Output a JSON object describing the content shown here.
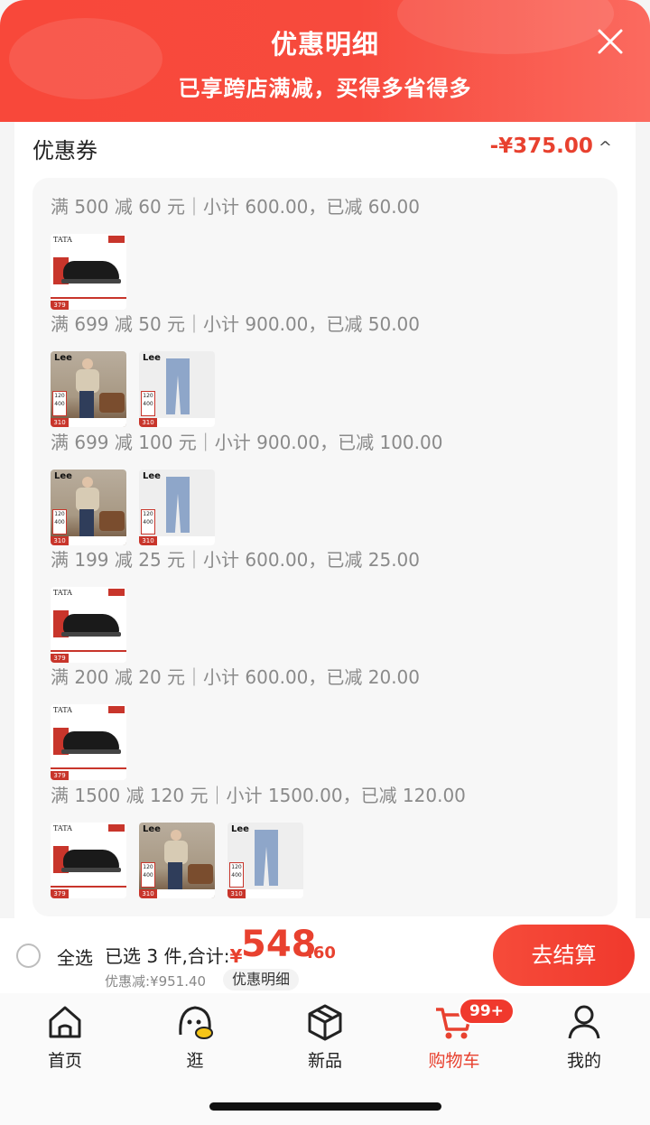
{
  "header": {
    "title": "优惠明细",
    "subtitle": "已享跨店满减，买得多省得多",
    "close_icon": "close-icon"
  },
  "coupon": {
    "label": "优惠券",
    "total": "-¥375.00",
    "caret": "^"
  },
  "groups": [
    {
      "rule": "满 500 减 60 元｜小计 600.00，已减 60.00",
      "items": [
        "shoe"
      ]
    },
    {
      "rule": "满 699 减 50 元｜小计 900.00，已减 50.00",
      "items": [
        "man",
        "jeans"
      ]
    },
    {
      "rule": "满 699 减 100 元｜小计 900.00，已减 100.00",
      "items": [
        "man",
        "jeans"
      ]
    },
    {
      "rule": "满 199 减 25 元｜小计 600.00，已减 25.00",
      "items": [
        "shoe"
      ]
    },
    {
      "rule": "满 200 减 20 元｜小计 600.00，已减 20.00",
      "items": [
        "shoe"
      ]
    },
    {
      "rule": "满 1500 减 120 元｜小计 1500.00，已减 120.00",
      "items": [
        "shoe",
        "man",
        "jeans"
      ]
    }
  ],
  "thumbs": {
    "shoe_brand": "TATA",
    "shoe_price": "379",
    "lee_brand": "Lee",
    "lee_price": "310",
    "lee_card_top": "120",
    "lee_card_bottom": "400"
  },
  "checkout": {
    "select_all": "全选",
    "summary": "已选 3 件,合计:",
    "currency": "¥",
    "amount_int": "548",
    "amount_dec": ".60",
    "discount": "优惠减:¥951.40",
    "detail_button": "优惠明细",
    "pay_button": "去结算"
  },
  "tabbar": {
    "items": [
      {
        "label": "首页",
        "icon": "home-icon"
      },
      {
        "label": "逛",
        "icon": "browse-icon"
      },
      {
        "label": "新品",
        "icon": "box-icon"
      },
      {
        "label": "购物车",
        "icon": "cart-icon",
        "active": true
      },
      {
        "label": "我的",
        "icon": "profile-icon"
      }
    ],
    "cart_badge": "99+"
  },
  "colors": {
    "accent": "#e8412f",
    "header_red": "#f8483a",
    "text_gray": "#8a8a8a"
  }
}
